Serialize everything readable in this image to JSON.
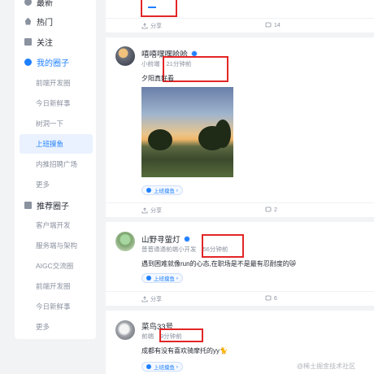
{
  "sidebar": {
    "items": [
      {
        "label": "最新",
        "icon": "latest-icon"
      },
      {
        "label": "热门",
        "icon": "flame-icon"
      },
      {
        "label": "关注",
        "icon": "follow-icon"
      },
      {
        "label": "我的圈子",
        "icon": "circle-icon"
      }
    ],
    "my_circles": [
      "前端开发圈",
      "今日新鲜事",
      "树洞一下",
      "上班摸鱼",
      "内推招聘广场",
      "更多"
    ],
    "recommend_title": "推荐圈子",
    "recommend": [
      "客户端开发",
      "服务端与架构",
      "AIGC交流圈",
      "前端开发圈",
      "今日新鲜事",
      "更多"
    ]
  },
  "top_card": {
    "share": "分享",
    "comments": "14"
  },
  "posts": [
    {
      "user": "嘻嘻嘿嘿哈哈",
      "title": "小前端",
      "time": "21分钟前",
      "content": "夕阳真好看",
      "tag": "上班摸鱼",
      "share": "分享",
      "comments": "2"
    },
    {
      "user": "山野寻萤灯",
      "title": "普普通通前端小开发",
      "time": "56分钟前",
      "content": "遇到困难就像run的心态,在职场是不是最有忍耐度的😿",
      "tag": "上班摸鱼",
      "share": "分享",
      "comments": "6"
    },
    {
      "user": "菜鸟33号",
      "title": "前端",
      "time": "9分钟前",
      "content": "成都有没有喜欢骑摩托的yy🐈",
      "tag": "上班摸鱼"
    }
  ],
  "watermark": "@稀土掘金技术社区",
  "colors": {
    "accent": "#1e80ff",
    "highlight_box": "#e32626",
    "background": "#f2f3f5"
  }
}
